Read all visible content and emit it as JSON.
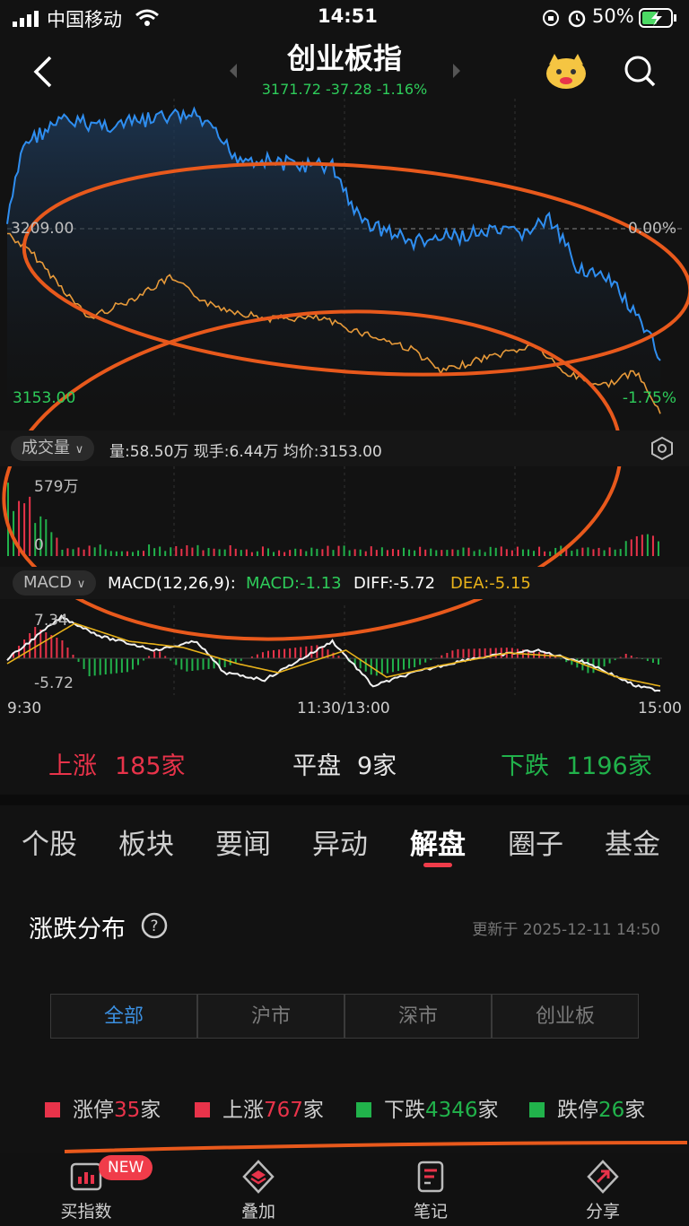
{
  "status_bar": {
    "carrier": "中国移动",
    "time": "14:51",
    "battery": "50%"
  },
  "header": {
    "title": "创业板指",
    "quote": "3171.72 -37.28 -1.16%"
  },
  "chart": {
    "base_price_label": "3209.00",
    "base_pct_label": "0.00%",
    "low_price_label": "3153.00",
    "low_pct_label": "-1.75%",
    "colors": {
      "price_line": "#2f8ef0",
      "avg_line": "#e79a3a",
      "up": "#e8334a",
      "down": "#21b24b",
      "annotation": "#e8591c"
    }
  },
  "volume": {
    "selector_label": "成交量",
    "info": "量:58.50万  现手:6.44万  均价:3153.00",
    "max_label": "579万",
    "min_label": "0"
  },
  "macd": {
    "selector_label": "MACD",
    "params": "MACD(12,26,9):",
    "macd_value": "MACD:-1.13",
    "diff_value": "DIFF:-5.72",
    "dea_value": "DEA:-5.15",
    "top_label": "7.34",
    "bottom_label": "-5.72"
  },
  "time_axis": {
    "start": "9:30",
    "middle": "11:30/13:00",
    "end": "15:00"
  },
  "breadth": {
    "up_label": "上涨",
    "up_value": "185家",
    "flat_label": "平盘",
    "flat_value": "9家",
    "down_label": "下跌",
    "down_value": "1196家"
  },
  "tabs": [
    "个股",
    "板块",
    "要闻",
    "异动",
    "解盘",
    "圈子",
    "基金"
  ],
  "active_tab": "解盘",
  "distribution": {
    "title": "涨跌分布",
    "updated": "更新于 2025-12-11 14:50",
    "segments": [
      "全部",
      "沪市",
      "深市",
      "创业板"
    ],
    "legend": [
      {
        "name": "涨停",
        "value": "35",
        "suffix": "家",
        "color": "#e8334a"
      },
      {
        "name": "上涨",
        "value": "767",
        "suffix": "家",
        "color": "#e8334a"
      },
      {
        "name": "下跌",
        "value": "4346",
        "suffix": "家",
        "color": "#21b24b"
      },
      {
        "name": "跌停",
        "value": "26",
        "suffix": "家",
        "color": "#21b24b"
      }
    ]
  },
  "bottom_nav": {
    "badge": "NEW",
    "items": [
      "买指数",
      "叠加",
      "笔记",
      "分享"
    ]
  }
}
